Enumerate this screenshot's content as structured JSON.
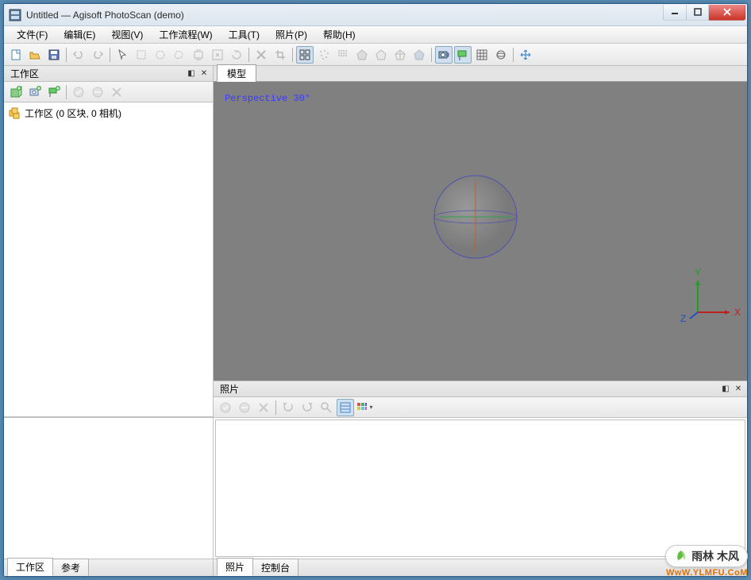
{
  "window": {
    "title": "Untitled — Agisoft PhotoScan (demo)"
  },
  "menu": {
    "file": "文件(F)",
    "edit": "编辑(E)",
    "view": "视图(V)",
    "workflow": "工作流程(W)",
    "tools": "工具(T)",
    "photo": "照片(P)",
    "help": "帮助(H)"
  },
  "panels": {
    "workspace_title": "工作区",
    "photos_title": "照片",
    "model_tab": "模型"
  },
  "tree": {
    "root": "工作区 (0 区块, 0 相机)"
  },
  "viewport": {
    "label": "Perspective 30°",
    "axes": {
      "x": "X",
      "y": "Y",
      "z": "Z"
    }
  },
  "tabs": {
    "workspace": "工作区",
    "reference": "参考",
    "photos": "照片",
    "console": "控制台"
  },
  "watermark": {
    "brand": "雨林   木风",
    "url": "WwW.YLMFU.CoM"
  }
}
